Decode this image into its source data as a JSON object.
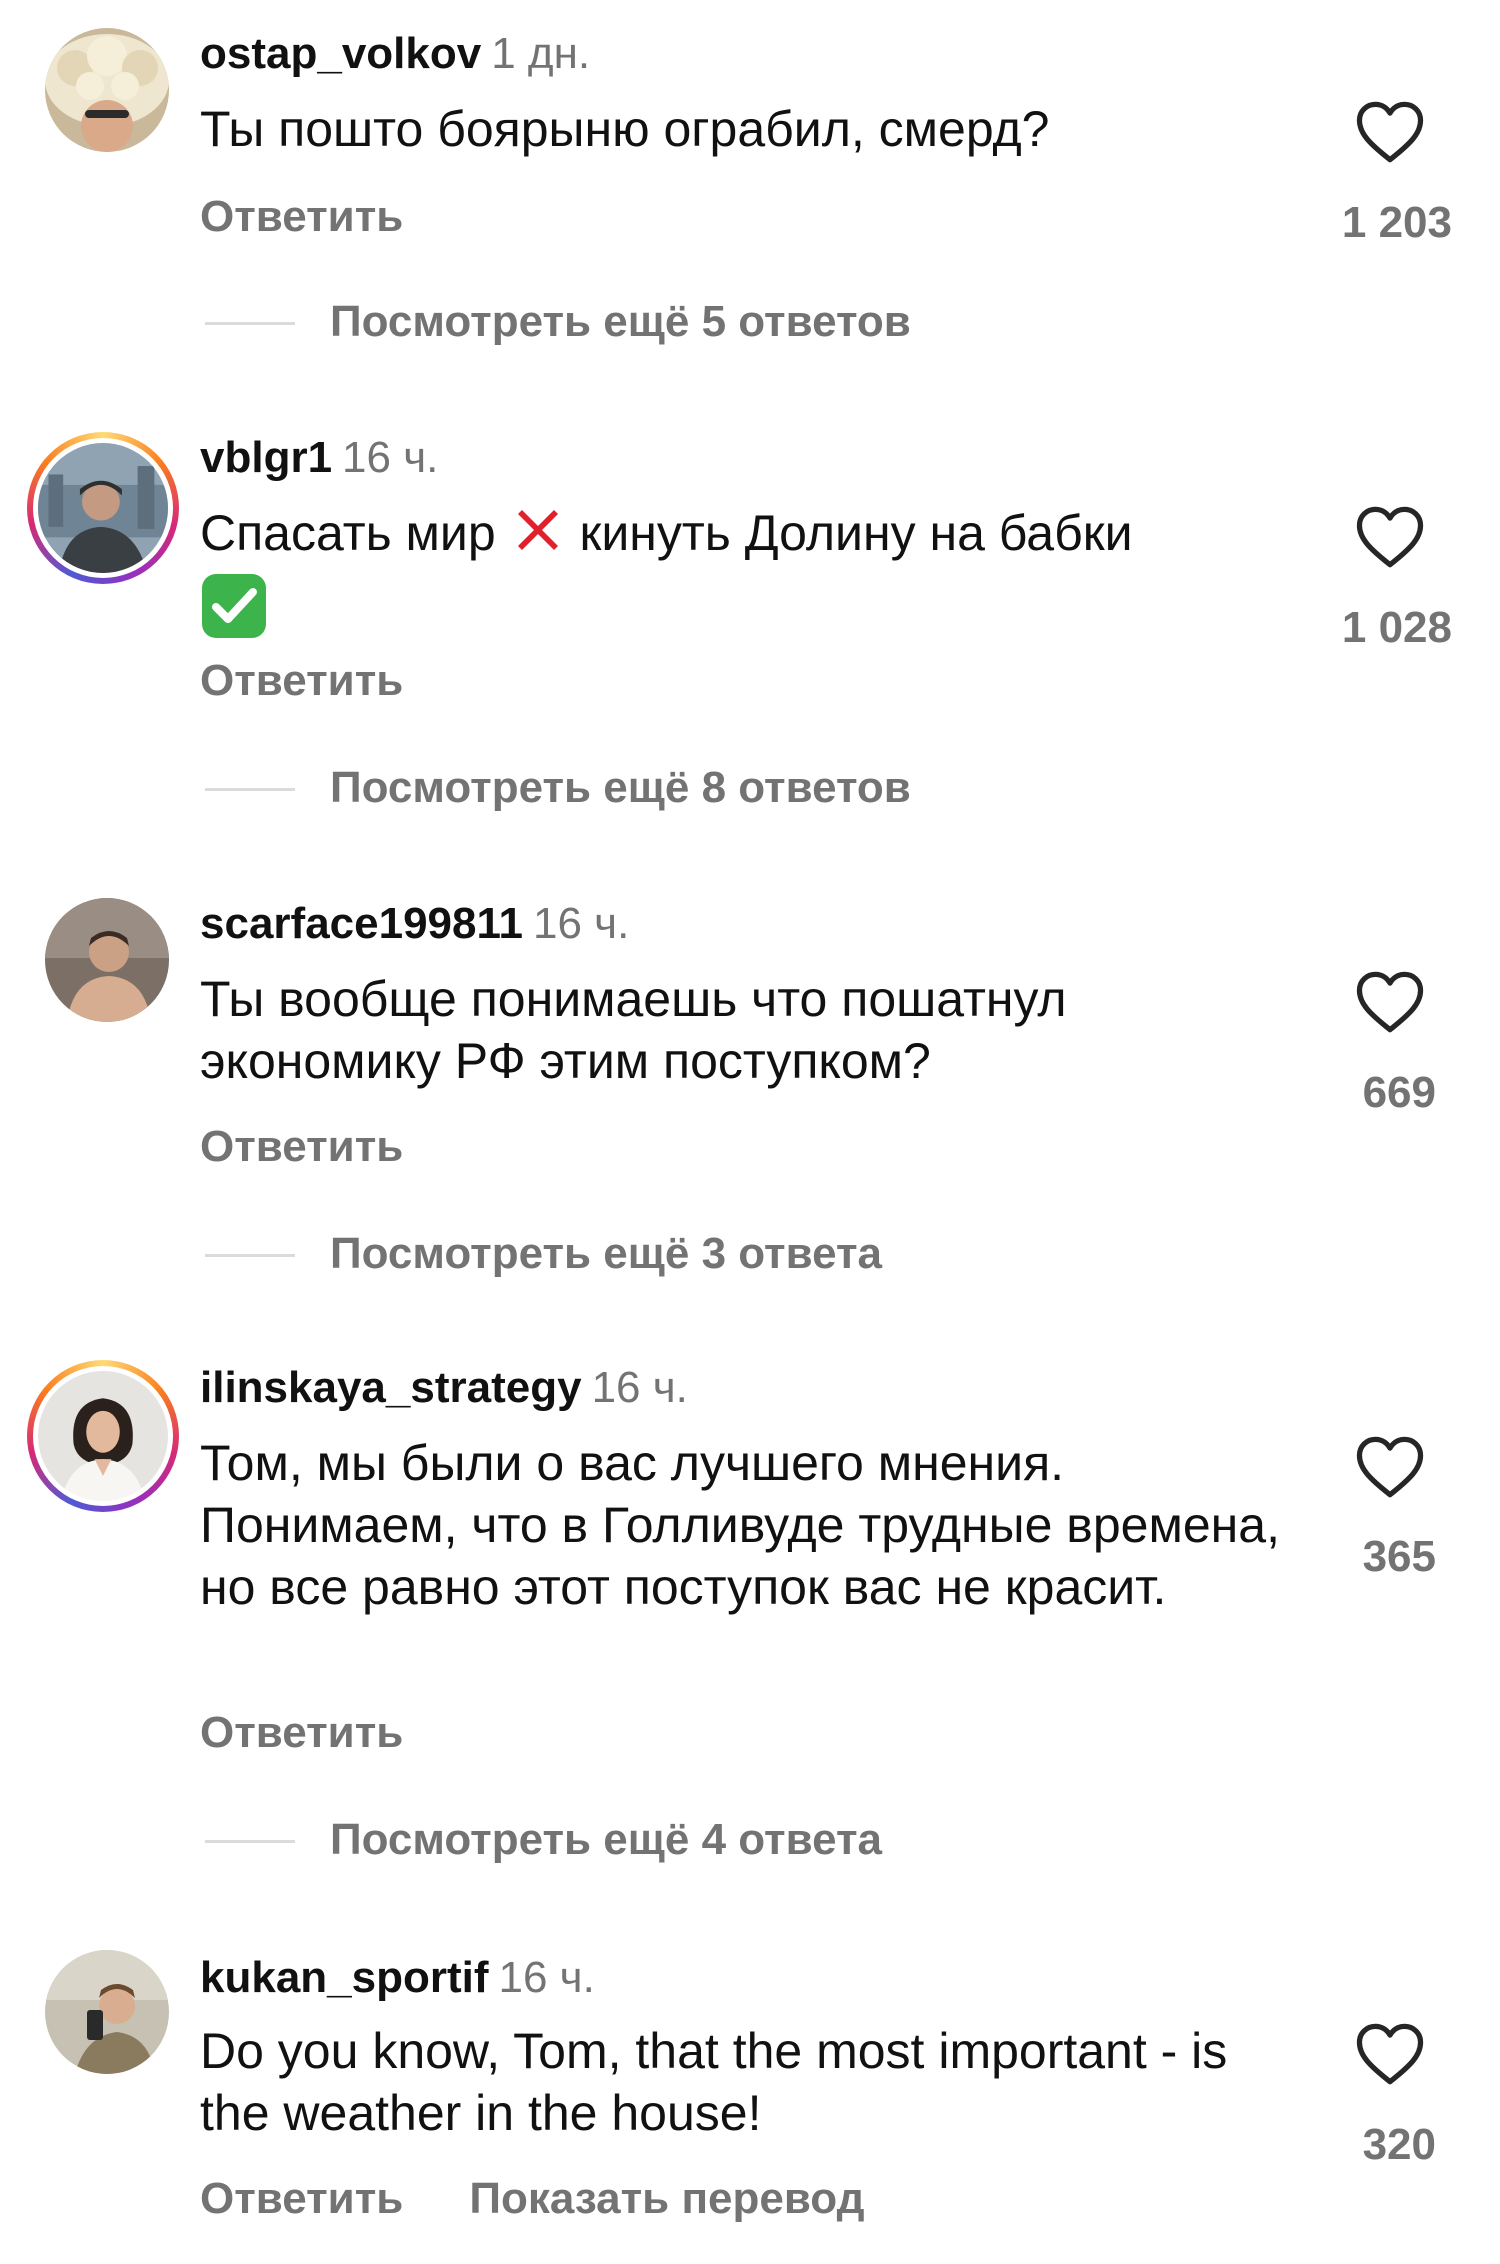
{
  "comments": [
    {
      "username": "ostap_volkov",
      "time": "1 дн.",
      "text": "Ты пошто боярыню ограбил, смерд?",
      "likes": "1 203",
      "reply": "Ответить",
      "more": "Посмотреть ещё 5 ответов"
    },
    {
      "username": "vblgr1",
      "time": "16 ч.",
      "text_parts": [
        "Спасать мир",
        "кинуть Долину на бабки"
      ],
      "emojis": [
        "cross-mark",
        "check-mark-button"
      ],
      "likes": "1 028",
      "reply": "Ответить",
      "more": "Посмотреть ещё 8 ответов"
    },
    {
      "username": "scarface199811",
      "time": "16 ч.",
      "text": "Ты вообще понимаешь что пошатнул экономику РФ этим поступком?",
      "likes": "669",
      "reply": "Ответить",
      "more": "Посмотреть ещё 3 ответа"
    },
    {
      "username": "ilinskaya_strategy",
      "time": "16 ч.",
      "text": "Том, мы были о вас лучшего мнения. Понимаем, что в Голливуде трудные времена, но все равно этот поступок вас не красит.",
      "likes": "365",
      "reply": "Ответить",
      "more": "Посмотреть ещё 4 ответа"
    },
    {
      "username": "kukan_sportif",
      "time": "16 ч.",
      "text": "Do you know, Tom, that the most important - is the weather in the house!",
      "likes": "320",
      "reply": "Ответить",
      "translate": "Показать перевод"
    }
  ],
  "icons": {
    "like": "heart-outline-icon"
  },
  "colors": {
    "text": "#111111",
    "muted": "#737373",
    "divider": "#dbdbdb",
    "story_ring": [
      "#feda75",
      "#fa7e1e",
      "#d62976",
      "#962fbf",
      "#4f5bd5"
    ]
  }
}
